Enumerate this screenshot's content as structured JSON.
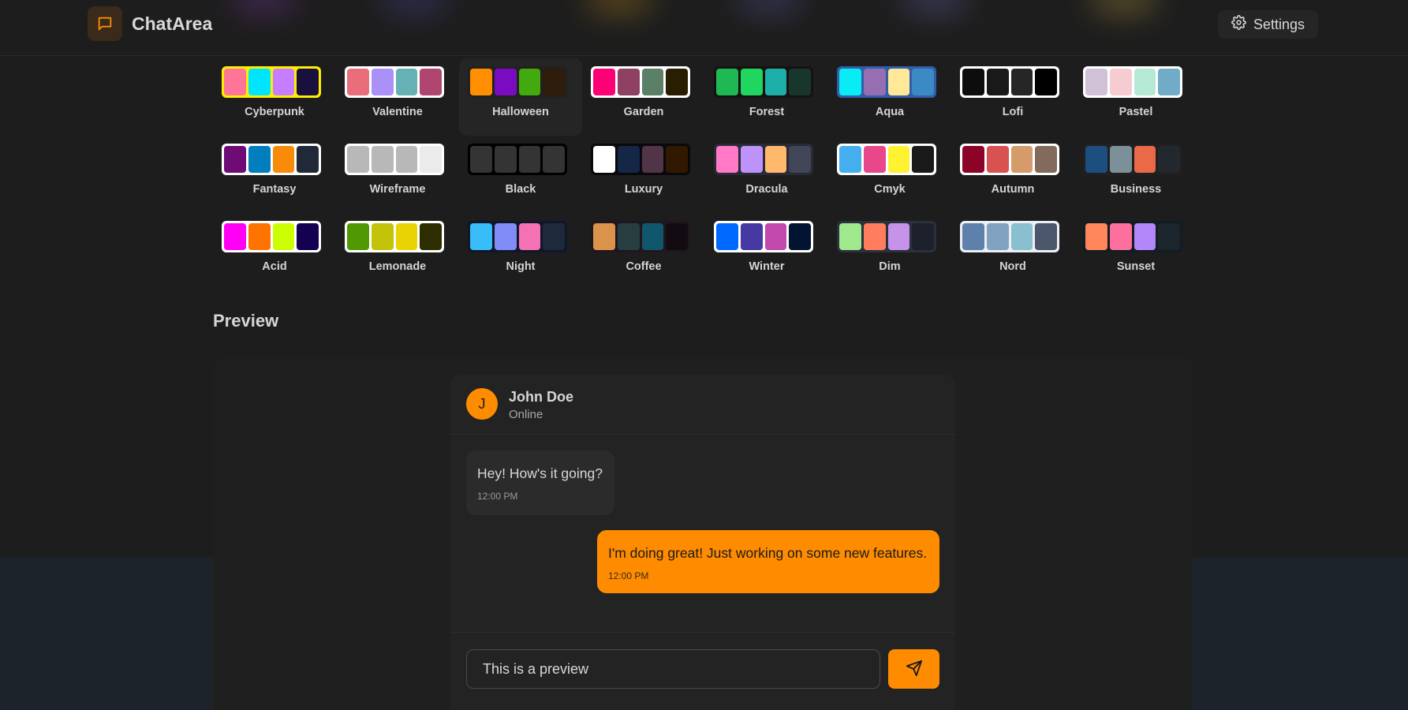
{
  "app": {
    "name": "ChatArea",
    "accent": "#ff8c00"
  },
  "header": {
    "settings_label": "Settings"
  },
  "themes": [
    {
      "name": "Cyberpunk",
      "border": "#ffee00",
      "colors": [
        "#ff7598",
        "#00e5ff",
        "#c77dff",
        "#1a103d"
      ]
    },
    {
      "name": "Valentine",
      "border": "#ffffff",
      "colors": [
        "#e96d7b",
        "#a991f7",
        "#66b1b3",
        "#af4670"
      ]
    },
    {
      "name": "Halloween",
      "border": "#212121",
      "colors": [
        "#ff8f00",
        "#7a0bc0",
        "#42aa0e",
        "#2f1c0a"
      ],
      "active": true
    },
    {
      "name": "Garden",
      "border": "#ffffff",
      "colors": [
        "#fe0075",
        "#8e4162",
        "#5c7f67",
        "#291e00"
      ]
    },
    {
      "name": "Forest",
      "border": "#171212",
      "colors": [
        "#1eb854",
        "#1fd65f",
        "#1db0a8",
        "#19362d"
      ]
    },
    {
      "name": "Aqua",
      "border": "#345da7",
      "colors": [
        "#09ecf3",
        "#966fb3",
        "#ffe999",
        "#3b8ac4"
      ]
    },
    {
      "name": "Lofi",
      "border": "#ffffff",
      "colors": [
        "#0d0d0d",
        "#1a1919",
        "#262626",
        "#000000"
      ]
    },
    {
      "name": "Pastel",
      "border": "#ffffff",
      "colors": [
        "#d1c1d7",
        "#f6cbd1",
        "#b4e9d6",
        "#70acc7"
      ]
    },
    {
      "name": "Fantasy",
      "border": "#ffffff",
      "colors": [
        "#6e0b75",
        "#007ebd",
        "#f88c08",
        "#1f2937"
      ]
    },
    {
      "name": "Wireframe",
      "border": "#ffffff",
      "colors": [
        "#b8b8b8",
        "#b8b8b8",
        "#b8b8b8",
        "#ebebeb"
      ]
    },
    {
      "name": "Black",
      "border": "#000000",
      "colors": [
        "#343434",
        "#343434",
        "#343434",
        "#343434"
      ]
    },
    {
      "name": "Luxury",
      "border": "#09090b",
      "colors": [
        "#ffffff",
        "#152747",
        "#513448",
        "#331800"
      ]
    },
    {
      "name": "Dracula",
      "border": "#282a36",
      "colors": [
        "#ff79c6",
        "#bd93f9",
        "#ffb86c",
        "#414558"
      ]
    },
    {
      "name": "Cmyk",
      "border": "#ffffff",
      "colors": [
        "#45aeee",
        "#e8488a",
        "#fff232",
        "#1a1a1a"
      ]
    },
    {
      "name": "Autumn",
      "border": "#ffffff",
      "colors": [
        "#8c0327",
        "#d85251",
        "#d59b6a",
        "#826a5c"
      ]
    },
    {
      "name": "Business",
      "border": "#202020",
      "colors": [
        "#1c4e80",
        "#7c909a",
        "#ea6947",
        "#23282e"
      ]
    },
    {
      "name": "Acid",
      "border": "#ffffff",
      "colors": [
        "#ff00f4",
        "#ff7400",
        "#cbfd03",
        "#140152"
      ]
    },
    {
      "name": "Lemonade",
      "border": "#ffffff",
      "colors": [
        "#519903",
        "#c3c30a",
        "#e8d303",
        "#2d2d00"
      ]
    },
    {
      "name": "Night",
      "border": "#0f1729",
      "colors": [
        "#38bdf8",
        "#818cf8",
        "#f471b5",
        "#1e293b"
      ]
    },
    {
      "name": "Coffee",
      "border": "#20161f",
      "colors": [
        "#db924b",
        "#263e3f",
        "#10576d",
        "#120c12"
      ]
    },
    {
      "name": "Winter",
      "border": "#ffffff",
      "colors": [
        "#0069ff",
        "#463aa2",
        "#c148ac",
        "#021431"
      ]
    },
    {
      "name": "Dim",
      "border": "#2a303c",
      "colors": [
        "#9fe88d",
        "#ff7d5c",
        "#c792e9",
        "#1c212b"
      ]
    },
    {
      "name": "Nord",
      "border": "#eceff4",
      "colors": [
        "#5e81ac",
        "#81a1c1",
        "#88c0d0",
        "#4c566a"
      ]
    },
    {
      "name": "Sunset",
      "border": "#121c22",
      "colors": [
        "#ff865b",
        "#fd6f9c",
        "#b387fa",
        "#1b262c"
      ]
    }
  ],
  "preview": {
    "title": "Preview",
    "contact": {
      "initial": "J",
      "name": "John Doe",
      "status": "Online"
    },
    "messages": [
      {
        "text": "Hey! How's it going?",
        "time": "12:00 PM",
        "direction": "incoming"
      },
      {
        "text": "I'm doing great! Just working on some new features.",
        "time": "12:00 PM",
        "direction": "outgoing"
      }
    ],
    "input_value": "This is a preview"
  }
}
